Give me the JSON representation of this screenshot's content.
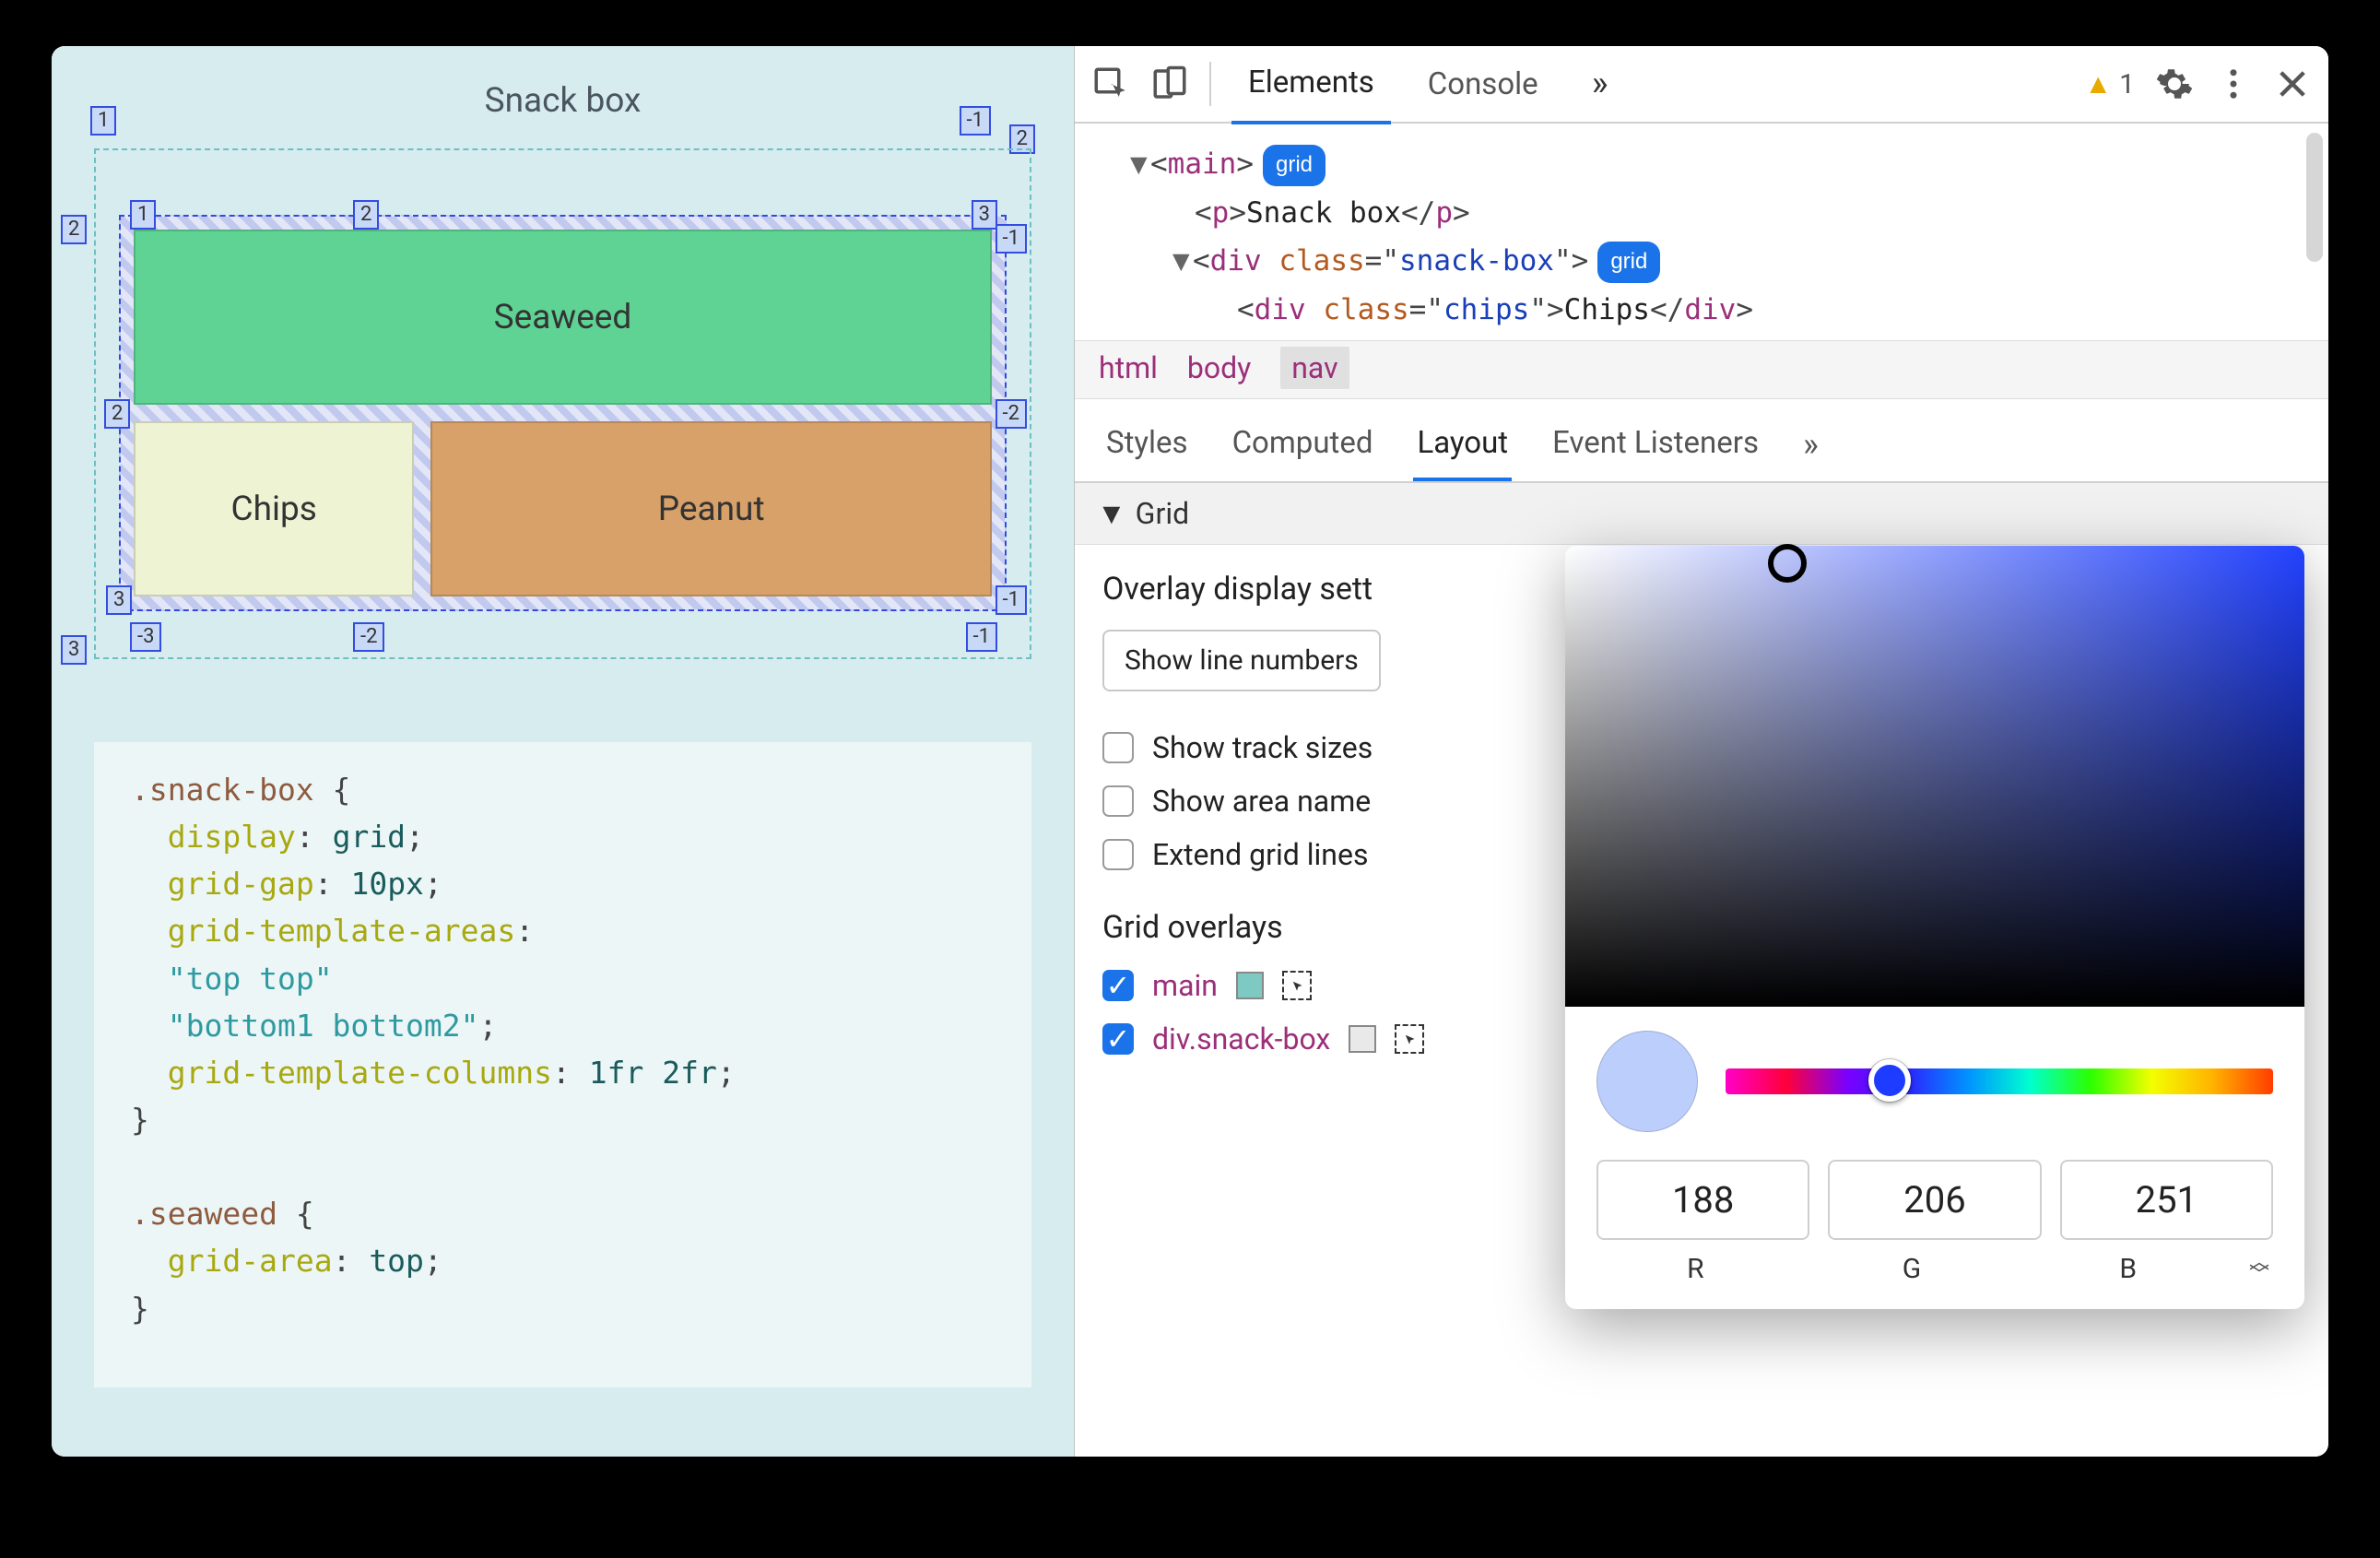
{
  "viewport": {
    "title": "Snack box",
    "cells": {
      "seaweed": "Seaweed",
      "chips": "Chips",
      "peanut": "Peanut"
    },
    "grid_labels": {
      "outer_top_left": "1",
      "outer_top_right_a": "-1",
      "outer_top_right_b": "2",
      "outer_left_2": "2",
      "outer_bottom_left": "3",
      "inner": {
        "t1": "1",
        "t2": "2",
        "t3": "3",
        "r_neg1": "-1",
        "l2": "2",
        "r_neg2": "-2",
        "b3": "3",
        "b_neg3": "-3",
        "b_neg2": "-2",
        "b_neg1": "-1"
      }
    },
    "code": {
      "sel1": ".snack-box",
      "l2k": "display",
      "l2v": "grid",
      "l3k": "grid-gap",
      "l3v": "10px",
      "l4k": "grid-template-areas",
      "l5": "\"top top\"",
      "l6": "\"bottom1 bottom2\"",
      "l7k": "grid-template-columns",
      "l7v": "1fr 2fr",
      "sel2": ".seaweed",
      "l9k": "grid-area",
      "l9v": "top"
    }
  },
  "devtools": {
    "tabs": {
      "elements": "Elements",
      "console": "Console"
    },
    "warning_count": "1",
    "dom": {
      "main_tag": "main",
      "grid_badge": "grid",
      "p_text": "Snack box",
      "div_class": "snack-box",
      "chips_class": "chips",
      "chips_text": "Chips"
    },
    "breadcrumb": [
      "html",
      "body",
      "nav"
    ],
    "subtabs": {
      "styles": "Styles",
      "computed": "Computed",
      "layout": "Layout",
      "event": "Event Listeners"
    },
    "grid_section": "Grid",
    "overlay_heading": "Overlay display sett",
    "select_label": "Show line numbers",
    "cb_track": "Show track sizes",
    "cb_area": "Show area name",
    "cb_extend": "Extend grid lines",
    "overlays_heading": "Grid overlays",
    "ov1_label": "main",
    "ov2_label": "div.snack-box"
  },
  "colorpicker": {
    "r": "188",
    "g": "206",
    "b": "251",
    "labels": {
      "r": "R",
      "g": "G",
      "b": "B"
    },
    "swatch": "#bccefb"
  }
}
